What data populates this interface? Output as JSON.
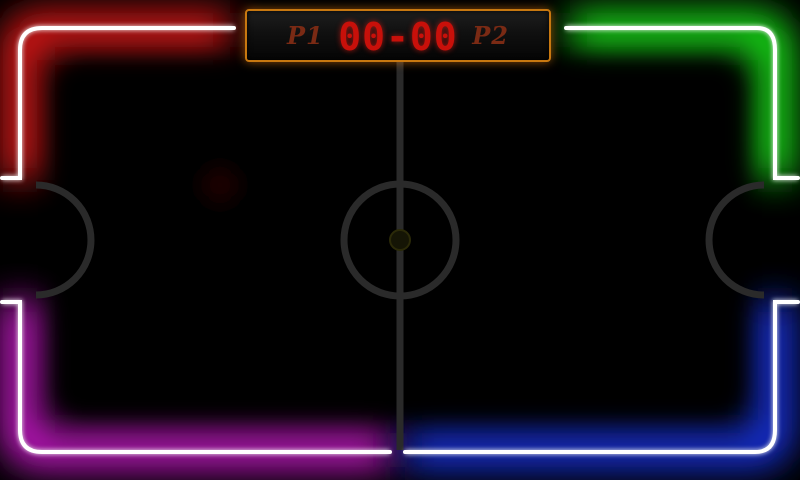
{
  "game": {
    "score": "00-00",
    "player1": "P1",
    "player2": "P2"
  },
  "colors": {
    "corner_top_left": "#ff2020",
    "corner_top_right": "#20ff20",
    "corner_bottom_left": "#e020e0",
    "corner_bottom_right": "#2040ff",
    "scoreboard_border": "#c87810",
    "score_text": "#c8100a",
    "player_text": "#7a2a14",
    "field_lines": "#2a2a2a",
    "rail": "#ffffff"
  }
}
